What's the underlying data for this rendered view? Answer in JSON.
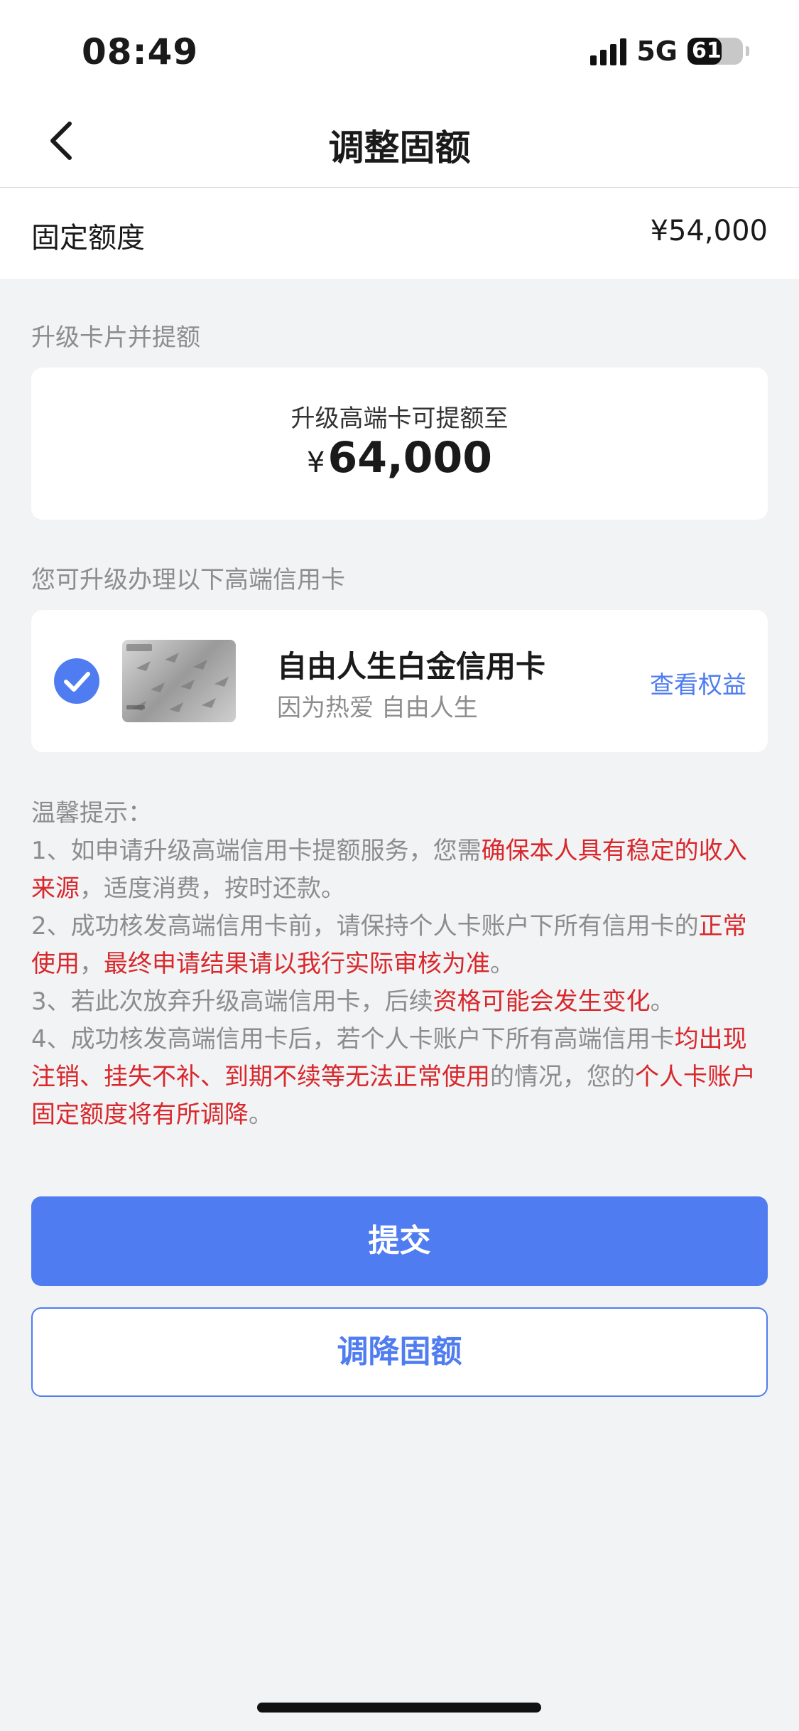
{
  "status_bar": {
    "time": "08:49",
    "network": "5G",
    "battery": "61",
    "battery_level": 0.61
  },
  "nav": {
    "title": "调整固额",
    "back_icon": "chevron-left-icon"
  },
  "quota": {
    "label": "固定额度",
    "value": "¥54,000"
  },
  "upgrade_section": {
    "title": "升级卡片并提额",
    "promo_text": "升级高端卡可提额至",
    "currency": "¥",
    "amount": "64,000"
  },
  "cards_section": {
    "title": "您可升级办理以下高端信用卡",
    "cards": [
      {
        "name": "自由人生白金信用卡",
        "slogan": "因为热爱 自由人生",
        "link": "查看权益",
        "selected": true
      }
    ]
  },
  "tips": {
    "title": "温馨提示：",
    "t1a": "1、如申请升级高端信用卡提额服务，您需",
    "t1b": "确保本人具有稳定的收入来源",
    "t1c": "，适度消费，按时还款。",
    "t2a": "2、成功核发高端信用卡前，请保持个人卡账户下所有信用卡的",
    "t2b": "正常使用",
    "t2c": "，",
    "t2d": "最终申请结果请以我行实际审核为准",
    "t2e": "。",
    "t3a": "3、若此次放弃升级高端信用卡，后续",
    "t3b": "资格可能会发生变化",
    "t3c": "。",
    "t4a": "4、成功核发高端信用卡后，若个人卡账户下所有高端信用卡",
    "t4b": "均出现注销、挂失不补、到期不续等无法正常使用",
    "t4c": "的情况，您的",
    "t4d": "个人卡账户固定额度将有所调降",
    "t4e": "。"
  },
  "actions": {
    "submit": "提交",
    "reduce": "调降固额"
  },
  "colors": {
    "accent": "#4f7cf0",
    "warning": "#d8282c",
    "muted": "#8d8d8d",
    "background": "#f2f3f5"
  }
}
